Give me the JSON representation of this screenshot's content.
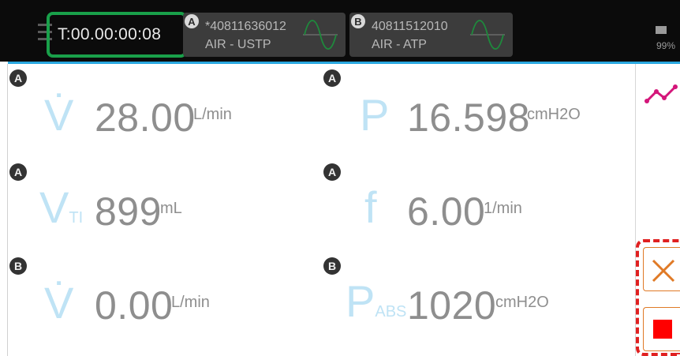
{
  "header": {
    "timer": "T:00.00:00:08",
    "battery_percent": "99%"
  },
  "devices": [
    {
      "badge": "A",
      "serial": "*40811636012",
      "mode": "AIR - USTP"
    },
    {
      "badge": "B",
      "serial": "40811512010",
      "mode": "AIR - ATP"
    }
  ],
  "measurements": [
    {
      "source": "A",
      "symbol": "V̇",
      "subscript": "",
      "value": "28.00",
      "unit": "L/min"
    },
    {
      "source": "A",
      "symbol": "P",
      "subscript": "",
      "value": "16.598",
      "unit": "cmH2O"
    },
    {
      "source": "A",
      "symbol": "V",
      "subscript": "TI",
      "value": "899",
      "unit": "mL"
    },
    {
      "source": "A",
      "symbol": "f",
      "subscript": "",
      "value": "6.00",
      "unit": "1/min"
    },
    {
      "source": "B",
      "symbol": "V̇",
      "subscript": "",
      "value": "0.00",
      "unit": "L/min"
    },
    {
      "source": "B",
      "symbol": "P",
      "subscript": "ABS",
      "value": "1020",
      "unit": "cmH2O"
    }
  ],
  "icons": {
    "menu": "menu-icon",
    "waveform": "sine-wave-icon",
    "battery": "battery-icon",
    "graph": "trend-graph-icon",
    "cancel": "close-icon",
    "stop": "stop-icon"
  },
  "colors": {
    "accent_line": "#2aa8e0",
    "timer_highlight": "#19a04a",
    "waveform": "#1e8a3c",
    "graph": "#d4167a",
    "action_orange": "#e07a26",
    "stop_red": "#ff0000",
    "highlight_dashed": "#e02020",
    "symbol_blue": "#bfe3f5"
  }
}
